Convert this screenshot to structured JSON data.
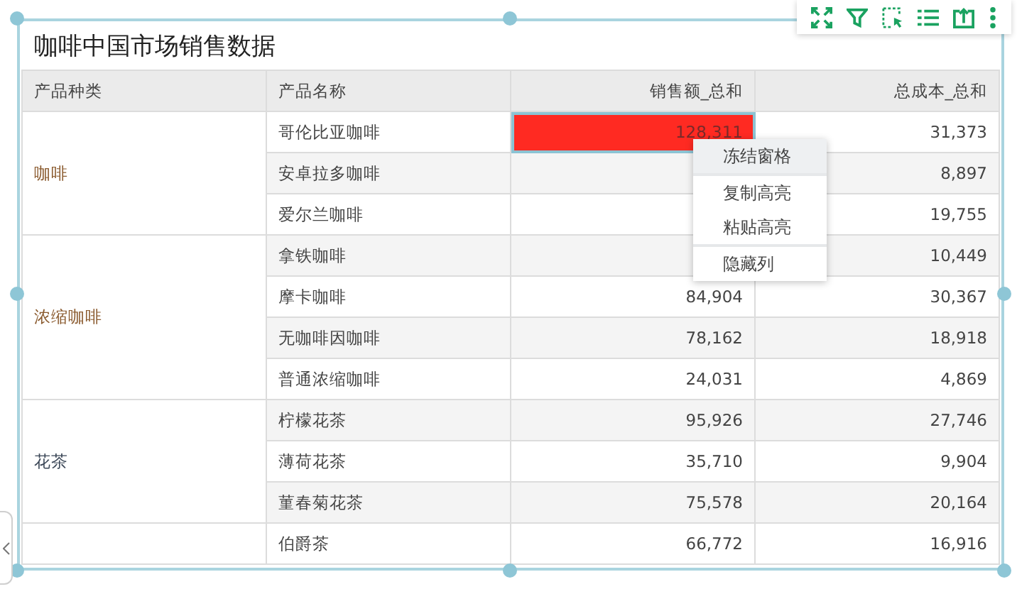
{
  "title": "咖啡中国市场销售数据",
  "toolbar": [
    {
      "kind": "expand"
    },
    {
      "kind": "filter"
    },
    {
      "kind": "select"
    },
    {
      "kind": "list"
    },
    {
      "kind": "export"
    },
    {
      "kind": "more"
    }
  ],
  "columns": [
    "产品种类",
    "产品名称",
    "销售额_总和",
    "总成本_总和"
  ],
  "groups": [
    {
      "category": "咖啡",
      "color": "#8a5a2e",
      "rows": [
        {
          "name": "哥伦比亚咖啡",
          "sales": "128,311",
          "cost": "31,373",
          "highlighted": true
        },
        {
          "name": "安卓拉多咖啡",
          "cost": "8,897",
          "highlighted": false
        },
        {
          "name": "爱尔兰咖啡",
          "cost": "19,755",
          "highlighted": false
        }
      ]
    },
    {
      "category": "浓缩咖啡",
      "color": "#8a5a2e",
      "rows": [
        {
          "name": "拿铁咖啡",
          "cost": "10,449",
          "highlighted": false
        },
        {
          "name": "摩卡咖啡",
          "sales": "84,904",
          "cost": "30,367",
          "highlighted": false
        },
        {
          "name": "无咖啡因咖啡",
          "sales": "78,162",
          "cost": "18,918",
          "highlighted": false
        },
        {
          "name": "普通浓缩咖啡",
          "sales": "24,031",
          "cost": "4,869",
          "highlighted": false
        }
      ]
    },
    {
      "category": "花茶",
      "color": "#3a4656",
      "rows": [
        {
          "name": "柠檬花茶",
          "sales": "95,926",
          "cost": "27,746",
          "highlighted": false
        },
        {
          "name": "薄荷花茶",
          "sales": "35,710",
          "cost": "9,904",
          "highlighted": false
        },
        {
          "name": "菫春菊花茶",
          "sales": "75,578",
          "cost": "20,164",
          "highlighted": false
        }
      ]
    },
    {
      "rows": [
        {
          "name": "伯爵茶",
          "sales": "66,772",
          "cost": "16,916",
          "highlighted": false
        }
      ]
    }
  ],
  "context_menu": [
    [
      {
        "label": "冻结窗格",
        "selected": true
      }
    ],
    [
      {
        "label": "复制高亮",
        "selected": false
      },
      {
        "label": "粘贴高亮",
        "selected": false
      }
    ],
    [
      {
        "label": "隐藏列",
        "selected": false
      }
    ]
  ]
}
